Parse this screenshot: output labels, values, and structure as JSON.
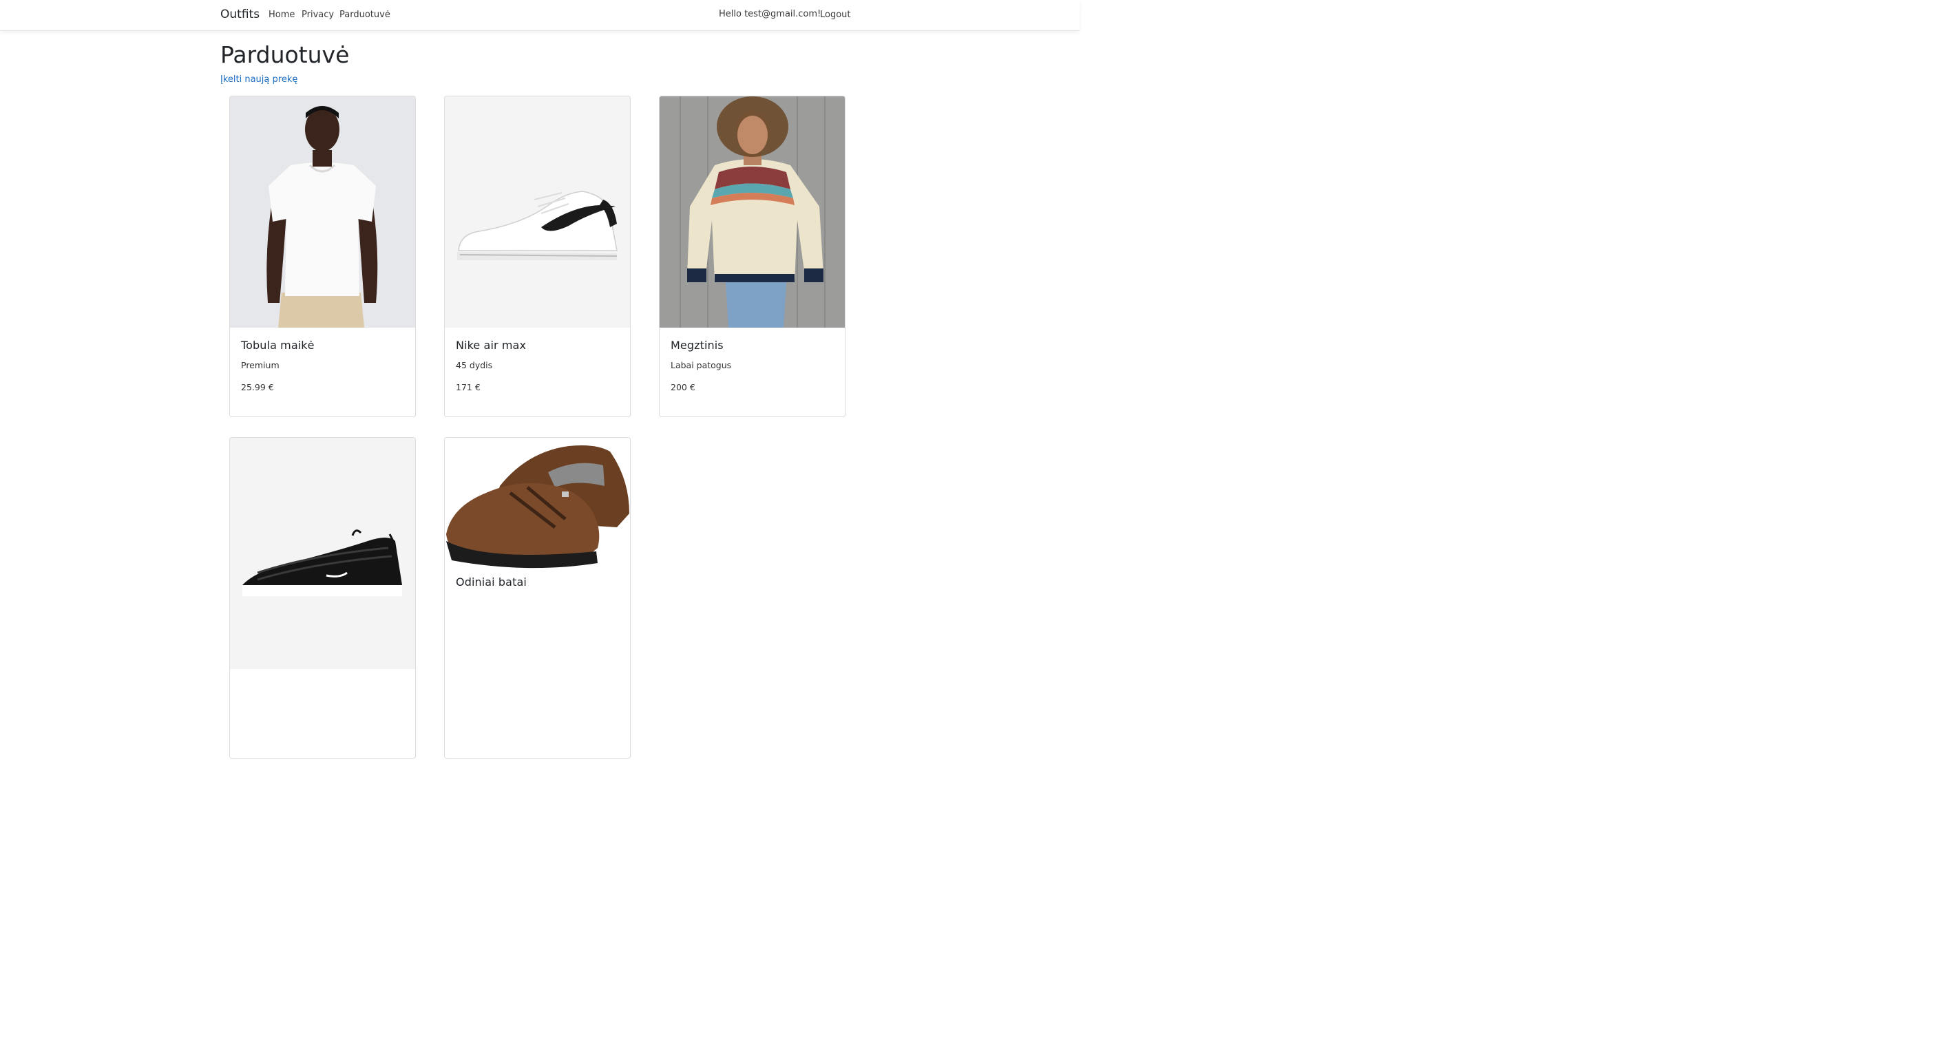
{
  "navbar": {
    "brand": "Outfits",
    "links": [
      "Home",
      "Privacy",
      "Parduotuvė"
    ],
    "greeting": "Hello test@gmail.com!",
    "logout": "Logout"
  },
  "main": {
    "title": "Parduotuvė",
    "create_link": "Įkelti naują prekę",
    "products": [
      {
        "name": "Tobula maikė",
        "description": "Premium",
        "price": "25.99 €"
      },
      {
        "name": "Nike air max",
        "description": "45 dydis",
        "price": "171 €"
      },
      {
        "name": "Megztinis",
        "description": "Labai patogus",
        "price": "200 €"
      },
      {
        "name": "",
        "description": "",
        "price": ""
      },
      {
        "name": "Odiniai batai",
        "description": "",
        "price": ""
      }
    ]
  },
  "colors": {
    "link": "#1b6ec2",
    "text": "#212529",
    "card_border": "#dcdcdc"
  }
}
